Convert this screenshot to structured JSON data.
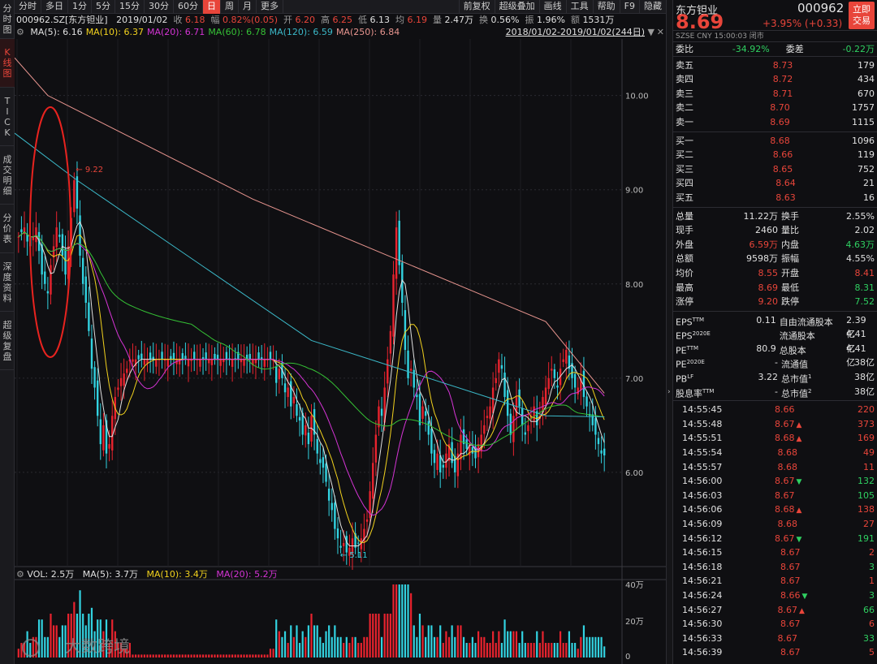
{
  "left_tabs": [
    {
      "label": "分时图",
      "chars": [
        "分",
        "时",
        "图"
      ],
      "active": false
    },
    {
      "label": "K线图",
      "chars": [
        "K",
        "线",
        "图"
      ],
      "active": true
    },
    {
      "label": "TICK",
      "chars": [
        "T",
        "I",
        "C",
        "K"
      ],
      "active": false
    },
    {
      "label": "成交明细",
      "chars": [
        "成",
        "交",
        "明",
        "细"
      ],
      "active": false
    },
    {
      "label": "分价表",
      "chars": [
        "分",
        "价",
        "表"
      ],
      "active": false
    },
    {
      "label": "深度资料",
      "chars": [
        "深",
        "度",
        "资",
        "料"
      ],
      "active": false
    },
    {
      "label": "超级复盘",
      "chars": [
        "超",
        "级",
        "复",
        "盘"
      ],
      "active": false
    }
  ],
  "toolbar": {
    "periods": [
      "分时",
      "多日",
      "1分",
      "5分",
      "15分",
      "30分",
      "60分",
      "日",
      "周",
      "月",
      "更多"
    ],
    "active_period": "日",
    "tools": [
      "前复权",
      "超级叠加",
      "画线",
      "工具",
      "帮助",
      "F9",
      "隐藏"
    ]
  },
  "info": {
    "code": "000962.SZ[东方钽业]",
    "date": "2019/01/02",
    "close_label": "收",
    "close": "6.18",
    "change_label": "幅",
    "change": "0.82%(0.05)",
    "open_label": "开",
    "open": "6.20",
    "high_label": "高",
    "high": "6.25",
    "low_label": "低",
    "low": "6.13",
    "avg_label": "均",
    "avg": "6.19",
    "vol_label": "量",
    "vol": "2.47万",
    "turn_label": "换",
    "turn": "0.56%",
    "amp_label": "振",
    "amp": "1.96%",
    "amt_label": "额",
    "amt": "1531万"
  },
  "ma": [
    {
      "label": "MA(5):",
      "value": "6.16",
      "color": "#e0e0e0"
    },
    {
      "label": "MA(10):",
      "value": "6.37",
      "color": "#f2d21e"
    },
    {
      "label": "MA(20):",
      "value": "6.71",
      "color": "#d534d5"
    },
    {
      "label": "MA(60):",
      "value": "6.78",
      "color": "#35c135"
    },
    {
      "label": "MA(120):",
      "value": "6.59",
      "color": "#3bb8c8"
    },
    {
      "label": "MA(250):",
      "value": "6.84",
      "color": "#e8958f"
    }
  ],
  "range": "2018/01/02-2019/01/02(244日)",
  "price_axis": [
    "10.00",
    "9.00",
    "8.00",
    "7.00",
    "6.00"
  ],
  "marks": {
    "high": "9.22",
    "low": "5.11"
  },
  "volume": {
    "vol_label": "VOL:",
    "vol": "2.5万",
    "ma5_label": "MA(5):",
    "ma5": "3.7万",
    "ma10_label": "MA(10):",
    "ma10": "3.4万",
    "ma20_label": "MA(20):",
    "ma20": "5.2万",
    "axis": [
      "40万",
      "20万",
      "0"
    ]
  },
  "watermark": "大数跨境",
  "stock": {
    "name": "东方钽业",
    "code": "000962",
    "price": "8.69",
    "change": "+3.95% (+0.33)",
    "market": "SZSE  CNY  15:00:03  闭市",
    "trade_button": [
      "立即",
      "交易"
    ]
  },
  "ratio": {
    "label1": "委比",
    "value1": "-34.92%",
    "label2": "委差",
    "value2": "-0.22万"
  },
  "asks": [
    {
      "label": "卖五",
      "price": "8.73",
      "vol": "179"
    },
    {
      "label": "卖四",
      "price": "8.72",
      "vol": "434"
    },
    {
      "label": "卖三",
      "price": "8.71",
      "vol": "670"
    },
    {
      "label": "卖二",
      "price": "8.70",
      "vol": "1757"
    },
    {
      "label": "卖一",
      "price": "8.69",
      "vol": "1115"
    }
  ],
  "bids": [
    {
      "label": "买一",
      "price": "8.68",
      "vol": "1096"
    },
    {
      "label": "买二",
      "price": "8.66",
      "vol": "119"
    },
    {
      "label": "买三",
      "price": "8.65",
      "vol": "752"
    },
    {
      "label": "买四",
      "price": "8.64",
      "vol": "21"
    },
    {
      "label": "买五",
      "price": "8.63",
      "vol": "16"
    }
  ],
  "stats": [
    {
      "l1": "总量",
      "v1": "11.22万",
      "c1": "white",
      "l2": "换手",
      "v2": "2.55%",
      "c2": "white"
    },
    {
      "l1": "现手",
      "v1": "2460",
      "c1": "white",
      "l2": "量比",
      "v2": "2.02",
      "c2": "white"
    },
    {
      "l1": "外盘",
      "v1": "6.59万",
      "c1": "red",
      "l2": "内盘",
      "v2": "4.63万",
      "c2": "green"
    },
    {
      "l1": "总额",
      "v1": "9598万",
      "c1": "white",
      "l2": "振幅",
      "v2": "4.55%",
      "c2": "white"
    },
    {
      "l1": "均价",
      "v1": "8.55",
      "c1": "red",
      "l2": "开盘",
      "v2": "8.41",
      "c2": "red"
    },
    {
      "l1": "最高",
      "v1": "8.69",
      "c1": "red",
      "l2": "最低",
      "v2": "8.31",
      "c2": "green"
    },
    {
      "l1": "涨停",
      "v1": "9.20",
      "c1": "red",
      "l2": "跌停",
      "v2": "7.52",
      "c2": "green"
    }
  ],
  "fin": [
    {
      "l1": "EPS",
      "s1": "TTM",
      "v1": "0.11",
      "l2": "自由流通股本",
      "s2": "",
      "v2": "2.39亿"
    },
    {
      "l1": "EPS",
      "s1": "2020E",
      "v1": "",
      "l2": "流通股本",
      "s2": "",
      "v2": "4.41亿"
    },
    {
      "l1": "PE",
      "s1": "TTM",
      "v1": "80.9",
      "l2": "总股本",
      "s2": "",
      "v2": "4.41亿"
    },
    {
      "l1": "PE",
      "s1": "2020E",
      "v1": "-",
      "l2": "流通值",
      "s2": "",
      "v2": "38亿"
    },
    {
      "l1": "PB",
      "s1": "LF",
      "v1": "3.22",
      "l2": "总市值",
      "s2": "1",
      "v2": "38亿"
    },
    {
      "l1": "股息率",
      "s1": "TTM",
      "v1": "-",
      "l2": "总市值",
      "s2": "2",
      "v2": "38亿"
    }
  ],
  "ticks": [
    {
      "time": "14:55:45",
      "price": "8.66",
      "dir": "",
      "vol": "220",
      "vcolor": "red"
    },
    {
      "time": "14:55:48",
      "price": "8.67",
      "dir": "up",
      "vol": "373",
      "vcolor": "red"
    },
    {
      "time": "14:55:51",
      "price": "8.68",
      "dir": "up",
      "vol": "169",
      "vcolor": "red"
    },
    {
      "time": "14:55:54",
      "price": "8.68",
      "dir": "",
      "vol": "49",
      "vcolor": "red"
    },
    {
      "time": "14:55:57",
      "price": "8.68",
      "dir": "",
      "vol": "11",
      "vcolor": "red"
    },
    {
      "time": "14:56:00",
      "price": "8.67",
      "dir": "down",
      "vol": "132",
      "vcolor": "green"
    },
    {
      "time": "14:56:03",
      "price": "8.67",
      "dir": "",
      "vol": "105",
      "vcolor": "green"
    },
    {
      "time": "14:56:06",
      "price": "8.68",
      "dir": "up",
      "vol": "138",
      "vcolor": "red"
    },
    {
      "time": "14:56:09",
      "price": "8.68",
      "dir": "",
      "vol": "27",
      "vcolor": "red"
    },
    {
      "time": "14:56:12",
      "price": "8.67",
      "dir": "down",
      "vol": "191",
      "vcolor": "green"
    },
    {
      "time": "14:56:15",
      "price": "8.67",
      "dir": "",
      "vol": "2",
      "vcolor": "red"
    },
    {
      "time": "14:56:18",
      "price": "8.67",
      "dir": "",
      "vol": "3",
      "vcolor": "green"
    },
    {
      "time": "14:56:21",
      "price": "8.67",
      "dir": "",
      "vol": "1",
      "vcolor": "red"
    },
    {
      "time": "14:56:24",
      "price": "8.66",
      "dir": "down",
      "vol": "3",
      "vcolor": "green"
    },
    {
      "time": "14:56:27",
      "price": "8.67",
      "dir": "up",
      "vol": "66",
      "vcolor": "green"
    },
    {
      "time": "14:56:30",
      "price": "8.67",
      "dir": "",
      "vol": "6",
      "vcolor": "red"
    },
    {
      "time": "14:56:33",
      "price": "8.67",
      "dir": "",
      "vol": "33",
      "vcolor": "green"
    },
    {
      "time": "14:56:39",
      "price": "8.67",
      "dir": "",
      "vol": "5",
      "vcolor": "red"
    }
  ],
  "chart_data": {
    "type": "candlestick",
    "title": "000962.SZ[东方钽业]",
    "period": "日",
    "x_range": [
      "2018/01/02",
      "2019/01/02"
    ],
    "ylim": [
      5.0,
      10.6
    ],
    "y_ticks": [
      6.0,
      7.0,
      8.0,
      9.0,
      10.0
    ],
    "annotations": [
      {
        "label": "9.22",
        "y": 9.22
      },
      {
        "label": "5.11",
        "y": 5.11
      }
    ],
    "closes": [
      8.5,
      8.55,
      8.6,
      8.45,
      8.4,
      8.5,
      8.6,
      8.35,
      8.1,
      8.0,
      7.9,
      8.2,
      8.4,
      8.6,
      8.5,
      8.3,
      8.1,
      8.4,
      8.7,
      9.1,
      8.8,
      8.3,
      8.0,
      7.8,
      7.5,
      7.1,
      6.9,
      6.6,
      6.3,
      6.5,
      6.2,
      6.3,
      6.6,
      6.8,
      6.9,
      7.0,
      7.05,
      7.1,
      7.2,
      7.2,
      7.2,
      7.2,
      7.2,
      7.2,
      7.2,
      7.2,
      7.2,
      7.2,
      7.2,
      7.2,
      7.2,
      7.2,
      7.2,
      7.2,
      7.2,
      7.2,
      7.2,
      7.2,
      7.2,
      7.2,
      7.2,
      7.2,
      7.2,
      7.2,
      7.2,
      7.2,
      7.2,
      7.2,
      7.2,
      7.2,
      7.2,
      7.2,
      7.2,
      7.2,
      7.2,
      7.2,
      7.2,
      7.2,
      7.2,
      7.2,
      7.2,
      7.2,
      7.2,
      7.2,
      7.2,
      7.2,
      7.2,
      7.2,
      6.95,
      7.1,
      7.0,
      6.85,
      6.9,
      6.7,
      6.8,
      6.6,
      6.55,
      6.4,
      6.5,
      6.3,
      6.6,
      6.4,
      6.2,
      6.1,
      6.05,
      5.9,
      5.7,
      5.6,
      5.4,
      5.3,
      5.2,
      5.25,
      5.15,
      5.2,
      5.3,
      5.2,
      5.25,
      5.3,
      5.4,
      5.5,
      5.8,
      6.1,
      6.4,
      6.7,
      6.6,
      6.9,
      7.2,
      7.5,
      8.1,
      8.6,
      8.2,
      7.8,
      7.3,
      7.0,
      7.1,
      6.9,
      6.8,
      6.5,
      6.7,
      6.6,
      6.4,
      6.2,
      6.1,
      6.2,
      6.0,
      6.05,
      6.2,
      6.3,
      6.1,
      6.0,
      6.2,
      6.4,
      6.3,
      6.25,
      6.3,
      6.2,
      6.15,
      6.3,
      6.4,
      6.5,
      6.6,
      6.7,
      6.9,
      7.0,
      7.2,
      7.1,
      6.8,
      6.6,
      6.4,
      6.6,
      6.8,
      6.7,
      6.5,
      6.4,
      6.5,
      6.6,
      6.7,
      6.5,
      6.6,
      6.8,
      6.9,
      7.0,
      7.1,
      7.0,
      6.9,
      7.1,
      7.2,
      7.3,
      7.1,
      7.0,
      6.9,
      6.9,
      7.0,
      6.8,
      6.7,
      6.6,
      6.5,
      6.4,
      6.3,
      6.2,
      6.18
    ]
  }
}
